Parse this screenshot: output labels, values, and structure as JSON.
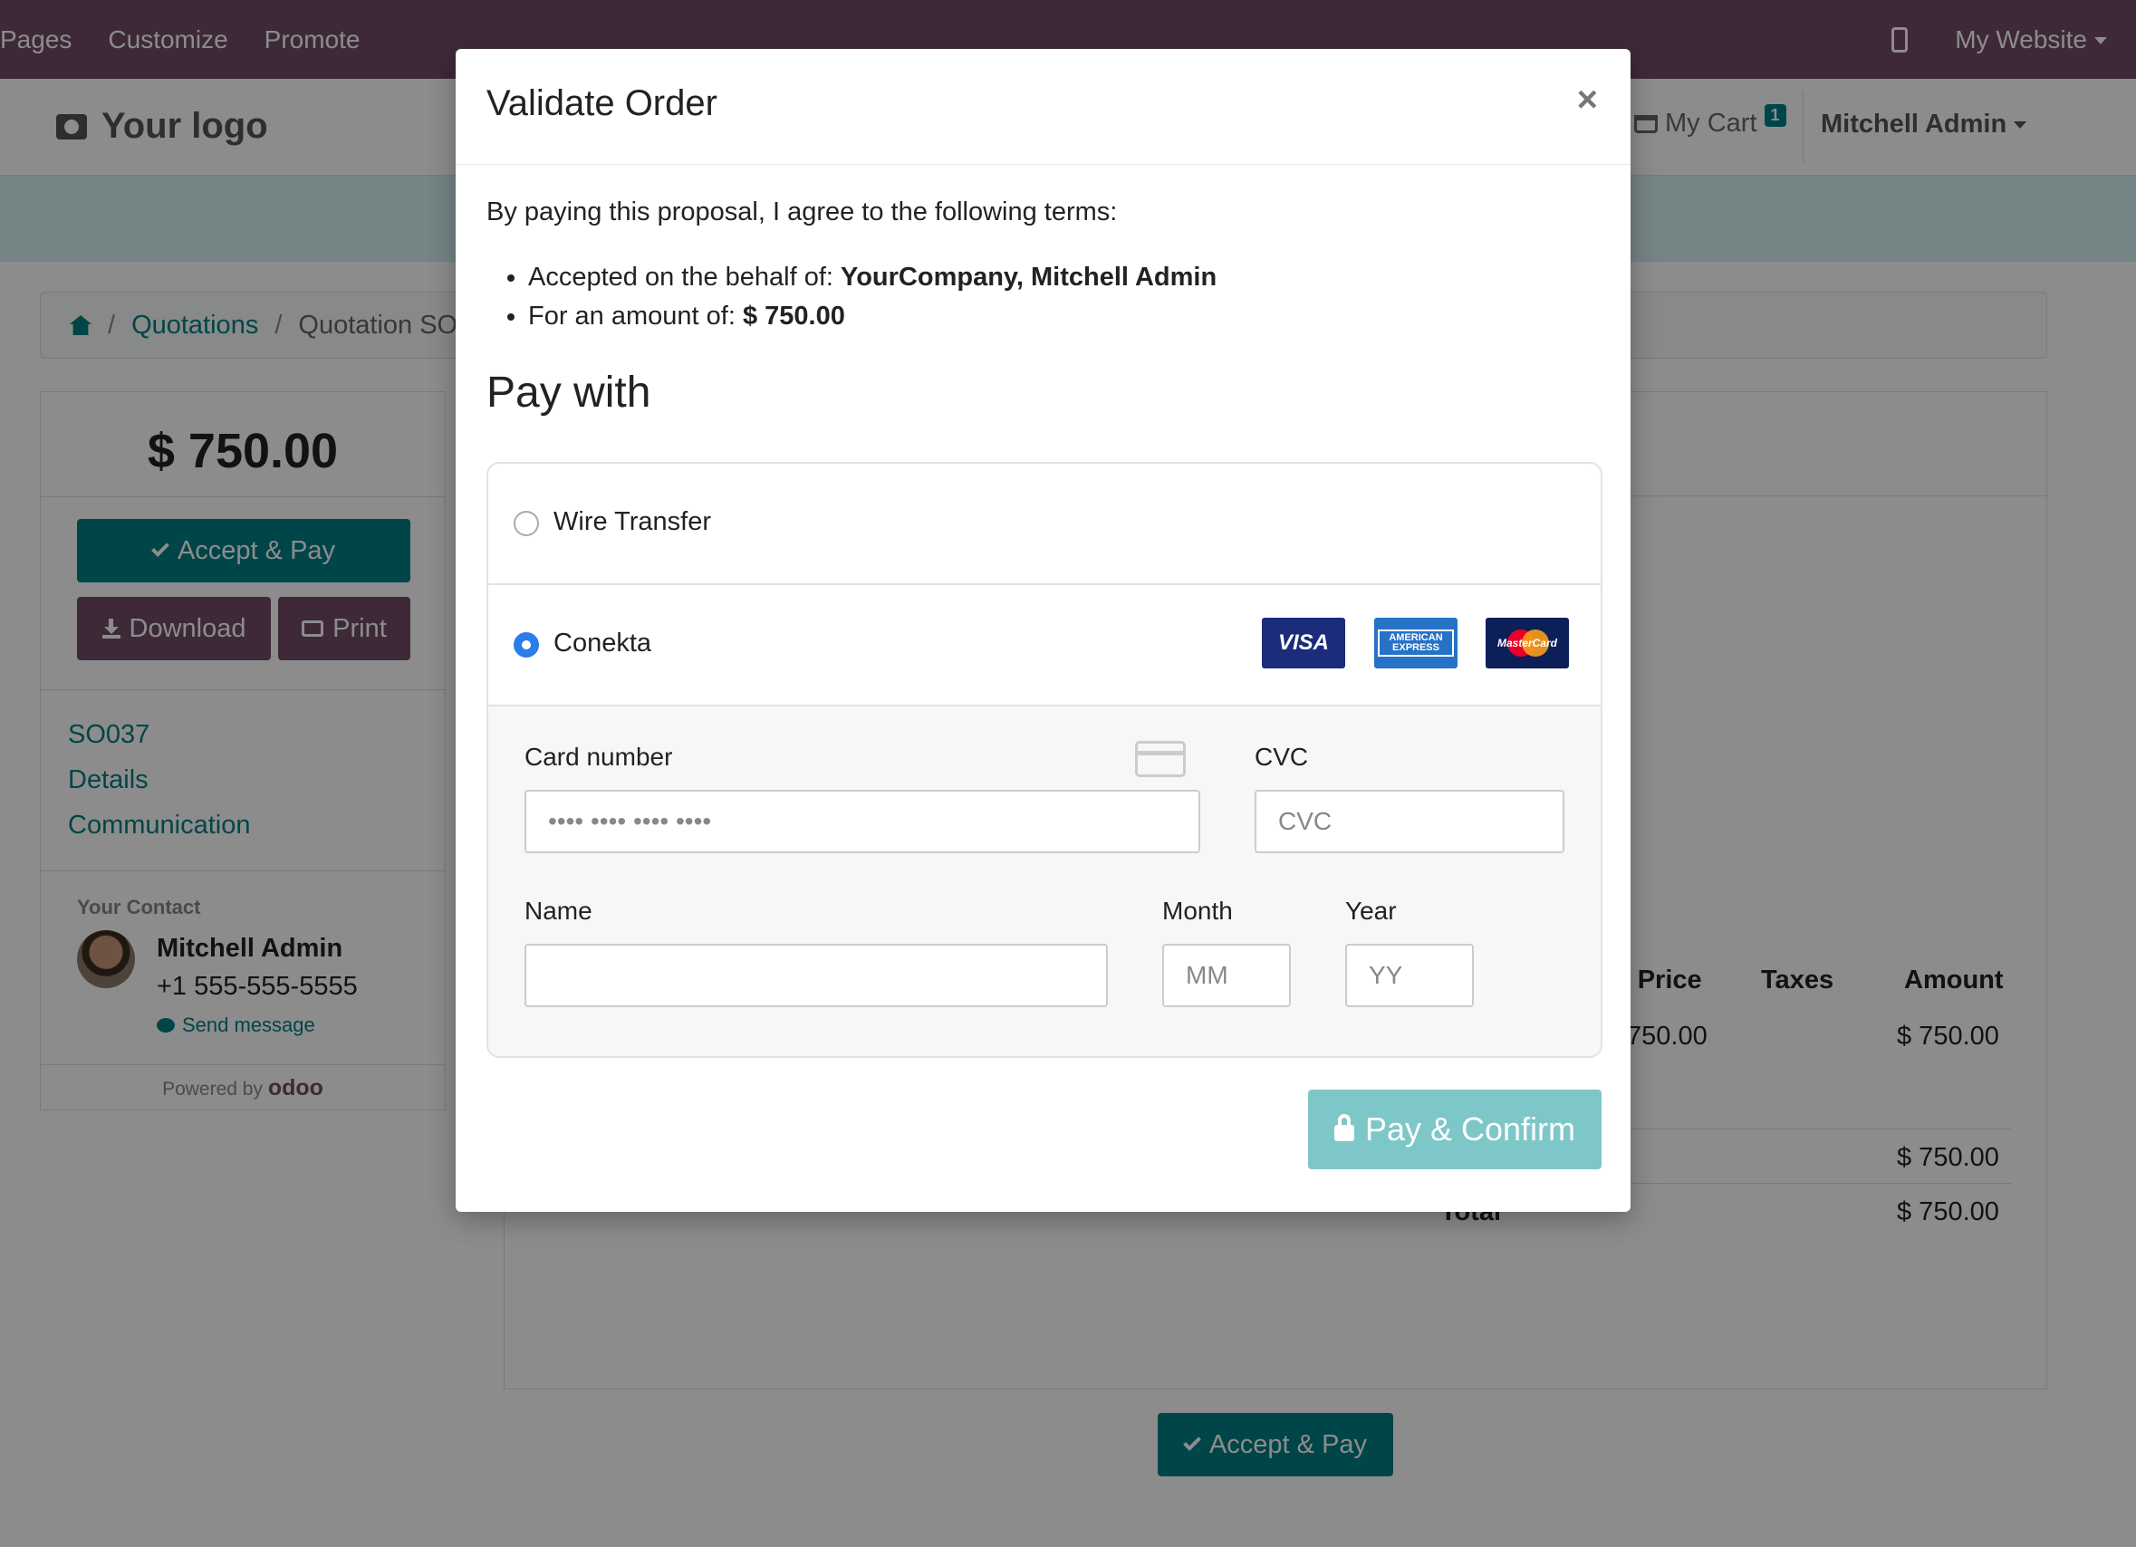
{
  "topbar": {
    "menu": [
      "Pages",
      "Customize",
      "Promote"
    ],
    "website_label": "My Website"
  },
  "header": {
    "logo_text": "Your logo",
    "cart_label": "My Cart",
    "cart_count": "1",
    "user_name": "Mitchell Admin"
  },
  "breadcrumb": {
    "items": [
      "Quotations",
      "Quotation SO"
    ]
  },
  "sidebar": {
    "amount": "$ 750.00",
    "accept_pay": "Accept & Pay",
    "download": "Download",
    "print": "Print",
    "links": [
      "SO037",
      "Details",
      "Communication"
    ],
    "contact_title": "Your Contact",
    "contact_name": "Mitchell Admin",
    "contact_phone": "+1 555-555-5555",
    "send_message": "Send message",
    "powered_by": "Powered by",
    "brand": "odoo"
  },
  "main": {
    "table_headers": [
      "t Price",
      "Taxes",
      "Amount"
    ],
    "row_unit_price": "750.00",
    "row_amount": "$ 750.00",
    "subtotal": "$ 750.00",
    "total_label": "Total",
    "total": "$ 750.00",
    "accept_pay_bottom": "Accept & Pay"
  },
  "modal": {
    "title": "Validate Order",
    "close": "×",
    "terms_intro": "By paying this proposal, I agree to the following terms:",
    "accepted_prefix": "Accepted on the behalf of: ",
    "accepted_value": "YourCompany, Mitchell Admin",
    "amount_prefix": "For an amount of: ",
    "amount_value": "$ 750.00",
    "pay_with": "Pay with",
    "methods": [
      {
        "label": "Wire Transfer",
        "selected": false
      },
      {
        "label": "Conekta",
        "selected": true
      }
    ],
    "card_brands": [
      "VISA",
      "AMERICAN EXPRESS",
      "MasterCard"
    ],
    "form": {
      "card_number_label": "Card number",
      "card_number_placeholder": "•••• •••• •••• ••••",
      "cvc_label": "CVC",
      "cvc_placeholder": "CVC",
      "name_label": "Name",
      "name_value": "",
      "month_label": "Month",
      "month_placeholder": "MM",
      "year_label": "Year",
      "year_placeholder": "YY"
    },
    "pay_confirm": "Pay & Confirm"
  },
  "colors": {
    "topbar": "#714b67",
    "primary": "#017e84",
    "pay_button": "#7ec7c8",
    "radio_selected": "#2b7de9"
  }
}
